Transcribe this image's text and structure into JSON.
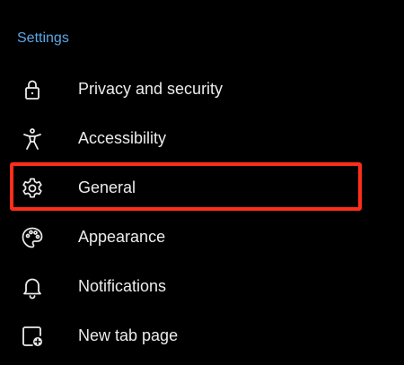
{
  "header": {
    "title": "Settings",
    "title_color": "#5aa7e8"
  },
  "menu": {
    "items": [
      {
        "label": "Privacy and security",
        "icon": "lock-icon"
      },
      {
        "label": "Accessibility",
        "icon": "accessibility-icon"
      },
      {
        "label": "General",
        "icon": "gear-icon",
        "highlighted": true
      },
      {
        "label": "Appearance",
        "icon": "palette-icon"
      },
      {
        "label": "Notifications",
        "icon": "bell-icon"
      },
      {
        "label": "New tab page",
        "icon": "new-tab-icon"
      }
    ]
  },
  "colors": {
    "background": "#000000",
    "text": "#ececec",
    "highlight_border": "#ff2d1a"
  }
}
